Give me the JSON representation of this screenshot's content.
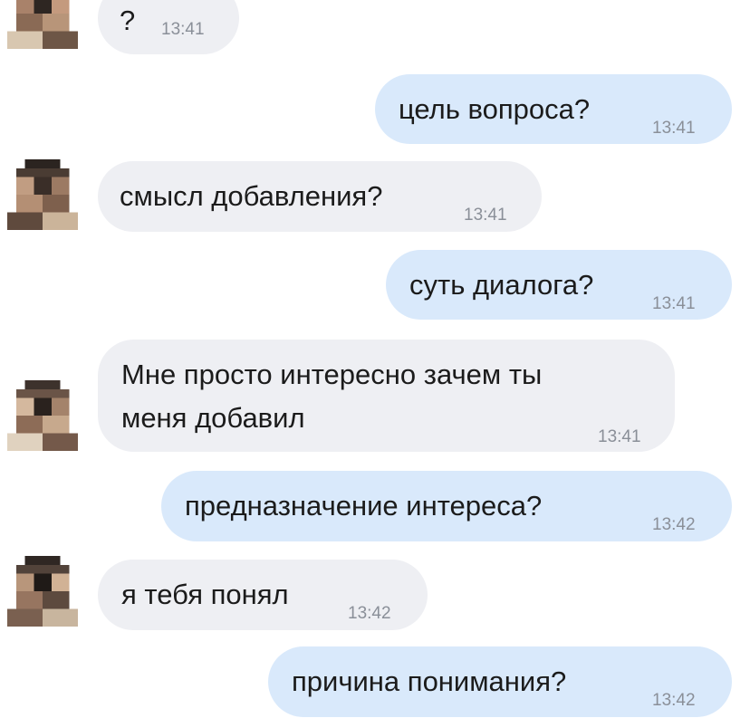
{
  "chat": {
    "messages": [
      {
        "direction": "incoming",
        "text": "?",
        "time": "13:41"
      },
      {
        "direction": "outgoing",
        "text": "цель вопроса?",
        "time": "13:41"
      },
      {
        "direction": "incoming",
        "text": "смысл добавления?",
        "time": "13:41"
      },
      {
        "direction": "outgoing",
        "text": "суть диалога?",
        "time": "13:41"
      },
      {
        "direction": "incoming",
        "text_line1": "Мне просто интересно зачем ты",
        "text_line2": "меня добавил",
        "time": "13:41"
      },
      {
        "direction": "outgoing",
        "text": "предназначение интереса?",
        "time": "13:42"
      },
      {
        "direction": "incoming",
        "text": "я тебя понял",
        "time": "13:42"
      },
      {
        "direction": "outgoing",
        "text": "причина понимания?",
        "time": "13:42"
      }
    ]
  },
  "colors": {
    "incoming_bubble": "#eeeff3",
    "outgoing_bubble": "#d9e9fb",
    "time_text": "#8a8f98"
  },
  "icons": {
    "avatar": "pixelated-avatar-icon"
  }
}
